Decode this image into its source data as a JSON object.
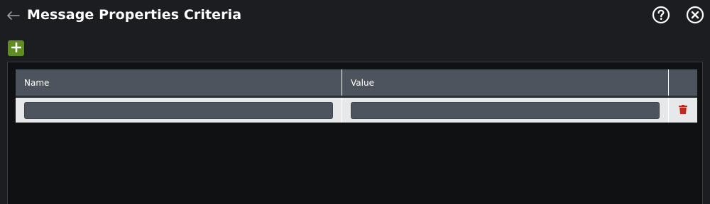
{
  "header": {
    "title": "Message Properties Criteria",
    "back_icon": "arrow-left-icon",
    "help_icon": "question-circle-icon",
    "close_icon": "close-circle-icon"
  },
  "toolbar": {
    "add_icon": "plus-icon",
    "add_color": "#5f8d1f"
  },
  "table": {
    "columns": [
      "Name",
      "Value",
      ""
    ],
    "rows": [
      {
        "name": "",
        "value": "",
        "delete_icon": "trash-icon"
      }
    ],
    "delete_color": "#c0271e"
  }
}
